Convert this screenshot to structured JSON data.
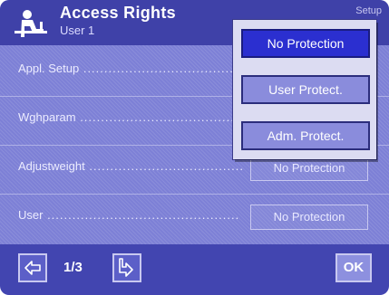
{
  "header": {
    "title": "Access Rights",
    "subtitle": "User 1",
    "setup_label": "Setup",
    "icon": "user-at-desk-icon"
  },
  "rows": [
    {
      "label": "Appl. Setup",
      "value": ""
    },
    {
      "label": "Wghparam",
      "value": ""
    },
    {
      "label": "Adjustweight",
      "value": "No Protection"
    },
    {
      "label": "User",
      "value": "No Protection"
    }
  ],
  "popup": {
    "options": [
      {
        "label": "No Protection",
        "selected": true
      },
      {
        "label": "User Protect.",
        "selected": false
      },
      {
        "label": "Adm. Protect.",
        "selected": false
      }
    ]
  },
  "footer": {
    "page_indicator": "1/3",
    "prev_icon": "arrow-left-icon",
    "next_icon": "arrow-down-right-icon",
    "ok_label": "OK"
  },
  "colors": {
    "header_bg": "#3f41a8",
    "body_bg": "#7d80d6",
    "selected_option": "#2b2fd0",
    "option_bg": "#8a8cdc"
  }
}
